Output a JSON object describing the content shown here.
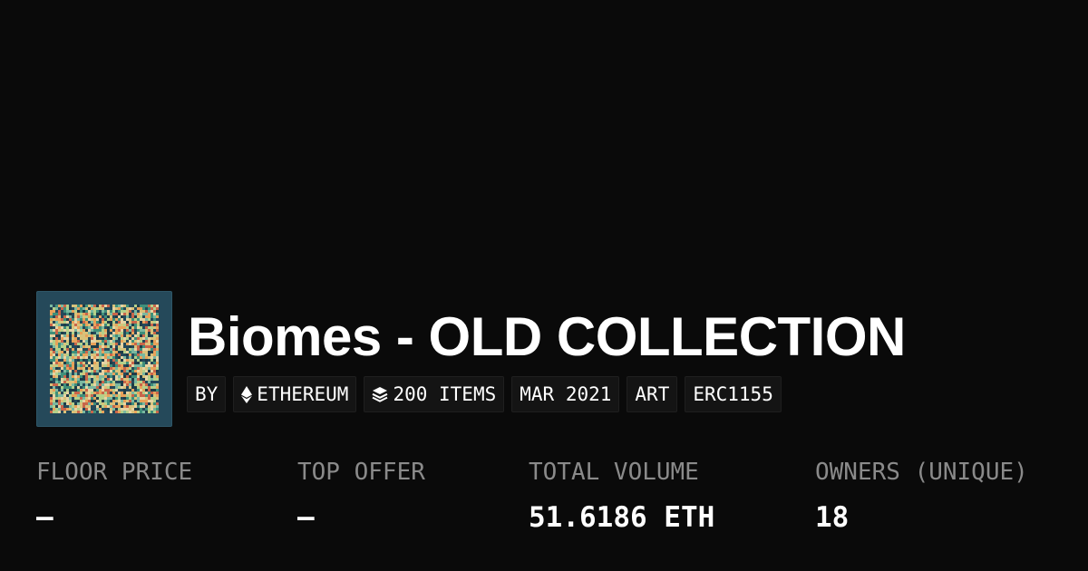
{
  "collection": {
    "title": "Biomes - OLD COLLECTION",
    "thumbnail_background": "#25495a"
  },
  "tags": {
    "by": "BY",
    "chain": "ETHEREUM",
    "chain_icon": "ethereum-icon",
    "items": "200 ITEMS",
    "items_icon": "layers-icon",
    "date": "MAR 2021",
    "category": "ART",
    "standard": "ERC1155"
  },
  "stats": {
    "floor_price": {
      "label": "FLOOR PRICE",
      "value": "—"
    },
    "top_offer": {
      "label": "TOP OFFER",
      "value": "—"
    },
    "total_volume": {
      "label": "TOTAL VOLUME",
      "value": "51.6186 ETH"
    },
    "owners": {
      "label": "OWNERS (UNIQUE)",
      "value": "18"
    }
  },
  "colors": {
    "background": "#0a0a0a",
    "text": "#ffffff",
    "muted": "#8a8a8a",
    "tag_background": "#141414"
  }
}
